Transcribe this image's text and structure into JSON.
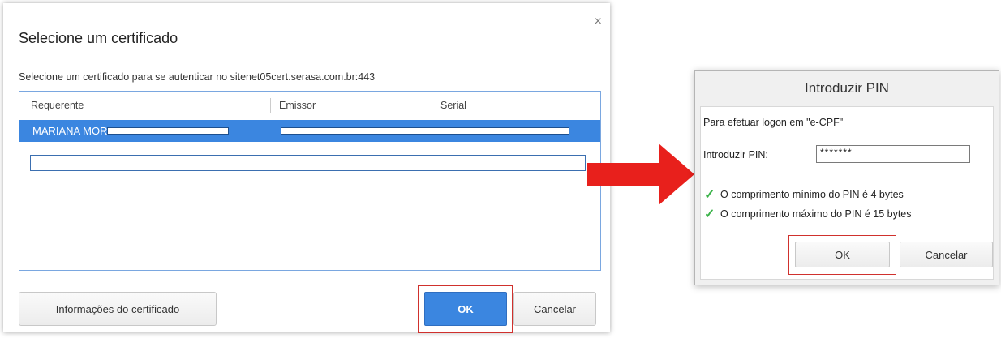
{
  "cert_dialog": {
    "title": "Selecione um certificado",
    "close_icon": "×",
    "subtitle": "Selecione um certificado para se autenticar no sitenet05cert.serasa.com.br:443",
    "columns": [
      "Requerente",
      "Emissor",
      "Serial"
    ],
    "selected_row_name": "MARIANA MORO",
    "info_button": "Informações do certificado",
    "ok_button": "OK",
    "cancel_button": "Cancelar"
  },
  "pin_dialog": {
    "title": "Introduzir PIN",
    "logon_text": "Para efetuar logon em \"e-CPF\"",
    "pin_label": "Introduzir PIN:",
    "pin_value": "*******",
    "rule_min": "O comprimento mínimo do PIN é 4 bytes",
    "rule_max": "O comprimento máximo do PIN é 15 bytes",
    "ok_button": "OK",
    "cancel_button": "Cancelar"
  },
  "colors": {
    "selection_blue": "#3b86e0",
    "highlight_red": "#d0312d",
    "arrow_red": "#e8201c",
    "check_green": "#3bb34a"
  }
}
